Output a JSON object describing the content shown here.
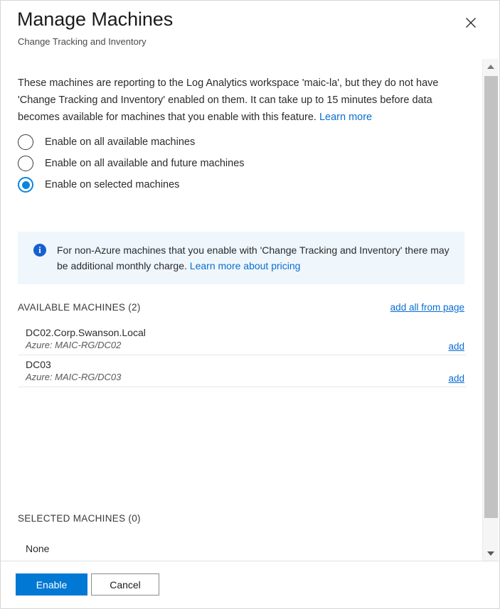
{
  "header": {
    "title": "Manage Machines",
    "subtitle": "Change Tracking and Inventory",
    "close_label": "close-icon"
  },
  "description": {
    "text": "These machines are reporting to the Log Analytics workspace 'maic-la', but they do not have 'Change Tracking and Inventory' enabled on them. It can take up to 15 minutes before data becomes available for machines that you enable with this feature.",
    "link_label": "Learn more"
  },
  "radio_group": {
    "selected_index": 2,
    "options": [
      {
        "label": "Enable on all available machines",
        "selected": false
      },
      {
        "label": "Enable on all available and future machines",
        "selected": false
      },
      {
        "label": "Enable on selected machines",
        "selected": true
      }
    ]
  },
  "info_banner": {
    "icon": "info-icon",
    "text": "For non-Azure machines that you enable with 'Change Tracking and Inventory' there may be additional monthly charge.",
    "link_label": "Learn more about pricing",
    "background_color": "#eff6fc",
    "icon_color": "#1560d0"
  },
  "available_machines": {
    "title": "AVAILABLE MACHINES (2)",
    "count": 2,
    "action_label": "add all from page",
    "rows": [
      {
        "name": "DC02.Corp.Swanson.Local",
        "subtitle": "Azure: MAIC-RG/DC02",
        "action_label": "add"
      },
      {
        "name": "DC03",
        "subtitle": "Azure: MAIC-RG/DC03",
        "action_label": "add"
      }
    ]
  },
  "selected_machines": {
    "title": "SELECTED MACHINES (0)",
    "count": 0,
    "empty_label": "None"
  },
  "footer": {
    "primary_label": "Enable",
    "secondary_label": "Cancel",
    "primary_color": "#0078d4"
  },
  "scrollbar": {
    "up_icon": "chevron-up-icon",
    "down_icon": "chevron-down-icon"
  }
}
